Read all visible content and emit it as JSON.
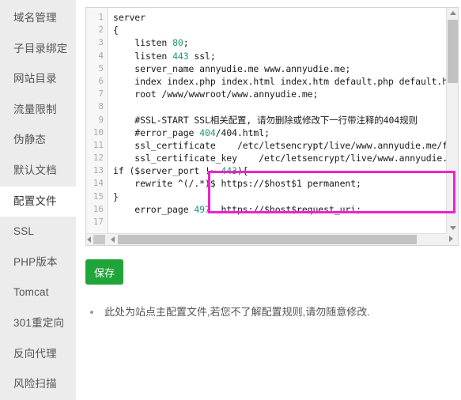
{
  "sidebar": {
    "items": [
      {
        "label": "域名管理",
        "active": false
      },
      {
        "label": "子目录绑定",
        "active": false
      },
      {
        "label": "网站目录",
        "active": false
      },
      {
        "label": "流量限制",
        "active": false
      },
      {
        "label": "伪静态",
        "active": false
      },
      {
        "label": "默认文档",
        "active": false
      },
      {
        "label": "配置文件",
        "active": true
      },
      {
        "label": "SSL",
        "active": false
      },
      {
        "label": "PHP版本",
        "active": false
      },
      {
        "label": "Tomcat",
        "active": false
      },
      {
        "label": "301重定向",
        "active": false
      },
      {
        "label": "反向代理",
        "active": false
      },
      {
        "label": "风险扫描",
        "active": false
      }
    ]
  },
  "editor": {
    "line_numbers": [
      "1",
      "2",
      "3",
      "4",
      "5",
      "6",
      "7",
      "8",
      "9",
      "10",
      "11",
      "12",
      "13",
      "14",
      "15",
      "16",
      "17"
    ],
    "lines": [
      "server",
      "{",
      "    listen 80;",
      "    listen 443 ssl;",
      "    server_name annyudie.me www.annyudie.me;",
      "    index index.php index.html index.htm default.php default.htm defau",
      "    root /www/wwwroot/www.annyudie.me;",
      "",
      "    #SSL-START SSL相关配置, 请勿删除或修改下一行带注释的404规则",
      "    #error_page 404/404.html;",
      "    ssl_certificate    /etc/letsencrypt/live/www.annyudie.me/fullchain",
      "    ssl_certificate_key    /etc/letsencrypt/live/www.annyudie.me/privk",
      "if ($server_port !~ 443){",
      "    rewrite ^(/.*)$ https://$host$1 permanent;",
      "}",
      "    error_page 497  https://$host$request_uri;",
      ""
    ],
    "highlight_note": "highlighted-block-lines-13-15"
  },
  "actions": {
    "save_label": "保存"
  },
  "notes": {
    "items": [
      "此处为站点主配置文件,若您不了解配置规则,请勿随意修改."
    ]
  },
  "colors": {
    "accent_green": "#20a53a",
    "highlight_pink": "#ee22cc",
    "sidebar_bg": "#ececec",
    "code_number": "#1a9a6e"
  }
}
